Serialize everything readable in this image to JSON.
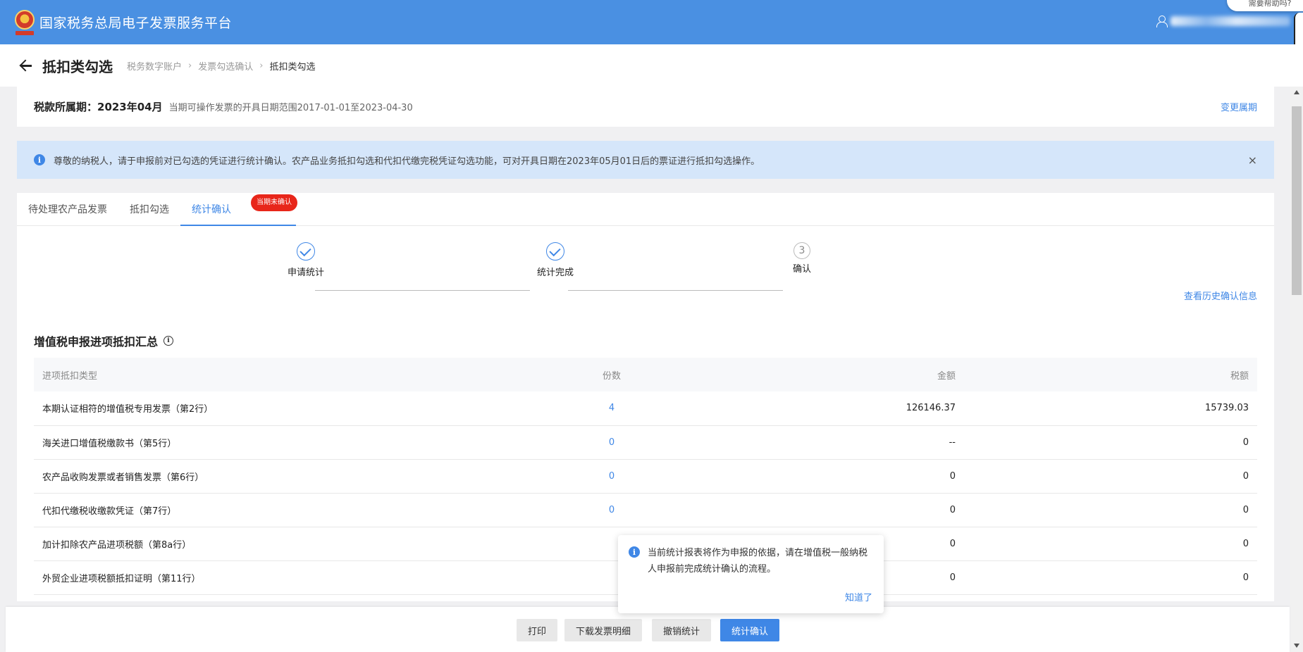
{
  "topbar": {
    "brand": "国家税务总局电子发票服务平台",
    "help_bubble": "需要帮助吗?"
  },
  "header": {
    "title": "抵扣类勾选",
    "breadcrumbs": [
      "税务数字账户",
      "发票勾选确认",
      "抵扣类勾选"
    ]
  },
  "period": {
    "label": "税款所属期：2023年04月",
    "range": "当期可操作发票的开具日期范围2017-01-01至2023-04-30",
    "change_link": "变更属期"
  },
  "notice": {
    "text": "尊敬的纳税人，请于申报前对已勾选的凭证进行统计确认。农产品业务抵扣勾选和代扣代缴完税凭证勾选功能，可对开具日期在2023年05月01日后的票证进行抵扣勾选操作。",
    "close": "×"
  },
  "tabs": [
    {
      "label": "待处理农产品发票"
    },
    {
      "label": "抵扣勾选"
    },
    {
      "label": "统计确认",
      "badge": "当期未确认"
    }
  ],
  "steps": [
    {
      "label": "申请统计",
      "status": "done"
    },
    {
      "label": "统计完成",
      "status": "done"
    },
    {
      "label": "确认",
      "status": "todo",
      "number": "3"
    }
  ],
  "history_link": "查看历史确认信息",
  "summary": {
    "title": "增值税申报进项抵扣汇总",
    "columns": [
      "进项抵扣类型",
      "份数",
      "金额",
      "税额"
    ],
    "rows": [
      [
        "本期认证相符的增值税专用发票（第2行）",
        "4",
        "126146.37",
        "15739.03"
      ],
      [
        "海关进口增值税缴款书（第5行）",
        "0",
        "--",
        "0"
      ],
      [
        "农产品收购发票或者销售发票（第6行）",
        "0",
        "0",
        "0"
      ],
      [
        "代扣代缴税收缴款凭证（第7行）",
        "0",
        "0",
        "0"
      ],
      [
        "加计扣除农产品进项税额（第8a行）",
        "",
        "0",
        "0"
      ],
      [
        "外贸企业进项税额抵扣证明（第11行）",
        "",
        "0",
        "0"
      ]
    ]
  },
  "popover": {
    "message": "当前统计报表将作为申报的依据，请在增值税一般纳税人申报前完成统计确认的流程。",
    "ok": "知道了"
  },
  "footer": {
    "print": "打印",
    "download": "下载发票明细",
    "revoke": "撤销统计",
    "confirm": "统计确认"
  },
  "colors": {
    "topbar": "#4a90e2",
    "accent": "#3f87e6",
    "badge": "#e8261a",
    "notice_bg": "#d5e6fa"
  }
}
